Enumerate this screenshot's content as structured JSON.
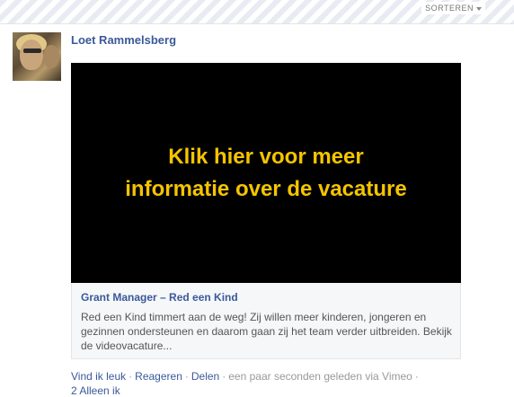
{
  "header": {
    "sort_label": "SORTEREN"
  },
  "post": {
    "author": "Loet Rammelsberg",
    "video": {
      "overlay_text": "Klik hier voor meer informatie over de vacature"
    },
    "link": {
      "title": "Grant Manager – Red een Kind",
      "description": "Red een Kind timmert aan de weg! Zij willen meer kinderen, jongeren en gezinnen ondersteunen en daarom gaan zij het team verder uitbreiden. Bekijk de videovacature..."
    },
    "actions": {
      "like": "Vind ik leuk",
      "comment": "Reageren",
      "share": "Delen",
      "timestamp": "een paar seconden geleden via Vimeo",
      "separator": "·"
    },
    "likes_line": "2 Alleen ik"
  }
}
